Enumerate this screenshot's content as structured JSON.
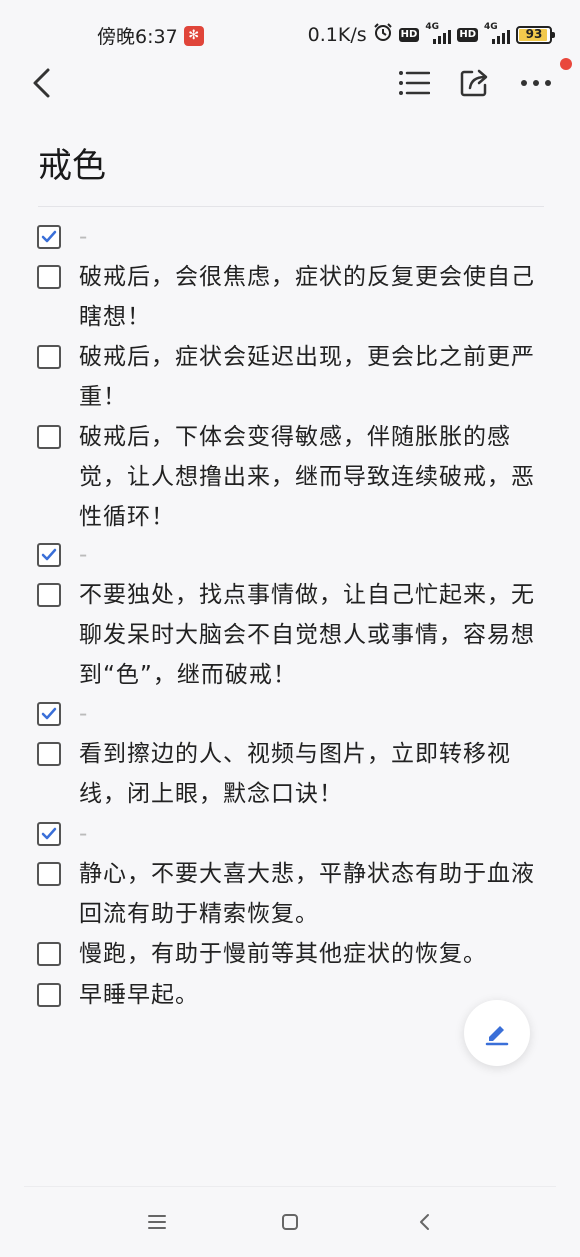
{
  "status_bar": {
    "time": "傍晚6:37",
    "net_speed": "0.1K/s",
    "hd_label": "HD",
    "network_type": "4G",
    "battery_level": "93"
  },
  "toolbar": {
    "back_icon": "chevron-left-icon",
    "list_icon": "checklist-icon",
    "share_icon": "share-icon",
    "more_icon": "more-dots-icon"
  },
  "note": {
    "title": "戒色",
    "items": [
      {
        "checked": true,
        "text": "-"
      },
      {
        "checked": false,
        "text": "破戒后，会很焦虑，症状的反复更会使自己瞎想！"
      },
      {
        "checked": false,
        "text": "破戒后，症状会延迟出现，更会比之前更严重！"
      },
      {
        "checked": false,
        "text": "破戒后，下体会变得敏感，伴随胀胀的感觉，让人想撸出来，继而导致连续破戒，恶性循环！"
      },
      {
        "checked": true,
        "text": "-"
      },
      {
        "checked": false,
        "text": "不要独处，找点事情做，让自己忙起来，无聊发呆时大脑会不自觉想人或事情，容易想到“色”，继而破戒！"
      },
      {
        "checked": true,
        "text": "-"
      },
      {
        "checked": false,
        "text": "看到擦边的人、视频与图片，立即转移视线，闭上眼，默念口诀！"
      },
      {
        "checked": true,
        "text": "-"
      },
      {
        "checked": false,
        "text": "静心，不要大喜大悲，平静状态有助于血液回流有助于精索恢复。"
      },
      {
        "checked": false,
        "text": "慢跑，有助于慢前等其他症状的恢复。"
      },
      {
        "checked": false,
        "text": "早睡早起。"
      }
    ]
  },
  "fab": {
    "icon": "edit-pencil-icon"
  },
  "nav_bar": {
    "menu_icon": "menu-icon",
    "home_icon": "home-icon",
    "back_icon": "back-icon"
  },
  "colors": {
    "accent": "#3a6fd8",
    "checkbox_border": "#555555",
    "background": "#f7f7f9"
  }
}
